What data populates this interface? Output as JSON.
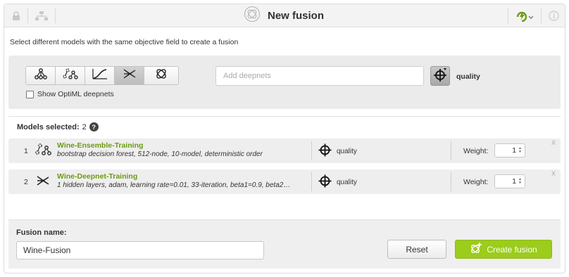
{
  "header": {
    "title": "New fusion",
    "icons": [
      "lock-icon",
      "network-icon",
      "fusion-logo-icon",
      "refresh-bolt-icon",
      "info-icon"
    ]
  },
  "instructions": "Select different models with the same objective field to create a fusion",
  "selector": {
    "model_type_buttons": [
      {
        "icon": "model-icon",
        "active": false
      },
      {
        "icon": "ensemble-icon",
        "active": false
      },
      {
        "icon": "logistic-regression-icon",
        "active": false
      },
      {
        "icon": "deepnet-icon",
        "active": true
      },
      {
        "icon": "fusion-icon",
        "active": false
      }
    ],
    "add_placeholder": "Add deepnets",
    "objective_field": "quality",
    "optiml_label": "Show OptiML deepnets",
    "optiml_checked": false
  },
  "models_selected": {
    "label": "Models selected:",
    "count": "2"
  },
  "models": [
    {
      "index": "1",
      "icon": "ensemble-icon",
      "name": "Wine-Ensemble-Training",
      "description": "bootstrap decision forest, 512-node, 10-model, deterministic order",
      "target": "quality",
      "weight_label": "Weight:",
      "weight": "1",
      "remove": "X"
    },
    {
      "index": "2",
      "icon": "deepnet-icon",
      "name": "Wine-Deepnet-Training",
      "description": "1 hidden layers, adam, learning rate=0.01, 33-iteration, beta1=0.9, beta2=...",
      "target": "quality",
      "weight_label": "Weight:",
      "weight": "1",
      "remove": "X"
    }
  ],
  "footer": {
    "fusion_name_label": "Fusion name:",
    "fusion_name_value": "Wine-Fusion",
    "reset_label": "Reset",
    "create_label": "Create fusion"
  },
  "colors": {
    "accent_green": "#9ccc1c",
    "model_name_green": "#6b9b12"
  }
}
